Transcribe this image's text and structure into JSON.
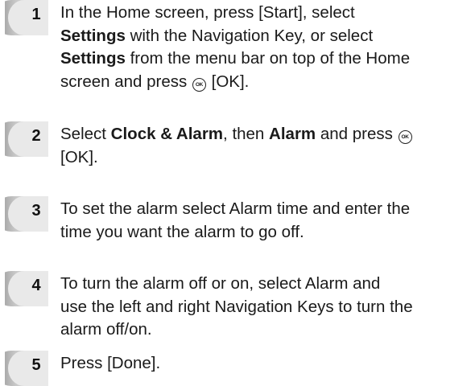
{
  "steps": [
    {
      "number": "1",
      "lines": [
        [
          {
            "t": "In the Home screen, press [Start], select"
          }
        ],
        [
          {
            "t": "Settings",
            "b": true
          },
          {
            "t": " with the Navigation Key, or select"
          }
        ],
        [
          {
            "t": "Settings",
            "b": true
          },
          {
            "t": " from the menu bar on top of the Home"
          }
        ],
        [
          {
            "t": "screen and press "
          },
          {
            "icon": "ok-key-icon"
          },
          {
            "t": " [OK]."
          }
        ]
      ]
    },
    {
      "number": "2",
      "lines": [
        [
          {
            "t": "Select "
          },
          {
            "t": "Clock & Alarm",
            "b": true
          },
          {
            "t": ", then "
          },
          {
            "t": "Alarm",
            "b": true
          },
          {
            "t": " and press "
          },
          {
            "icon": "ok-key-icon"
          }
        ],
        [
          {
            "t": "[OK]."
          }
        ]
      ]
    },
    {
      "number": "3",
      "lines": [
        [
          {
            "t": "To set the alarm select Alarm time and enter the"
          }
        ],
        [
          {
            "t": "time you want the alarm to go off."
          }
        ]
      ]
    },
    {
      "number": "4",
      "lines": [
        [
          {
            "t": "To turn the alarm off or on, select Alarm and"
          }
        ],
        [
          {
            "t": "use the left and right Navigation Keys to turn the"
          }
        ],
        [
          {
            "t": "alarm off/on."
          }
        ]
      ]
    },
    {
      "number": "5",
      "lines": [
        [
          {
            "t": "Press [Done]."
          }
        ]
      ]
    }
  ],
  "icons": {
    "ok_key_glyph": "OK"
  },
  "colors": {
    "badge_light": "#e4e4e4",
    "badge_dark": "#8f8f8f",
    "text": "#1a1a1a"
  }
}
